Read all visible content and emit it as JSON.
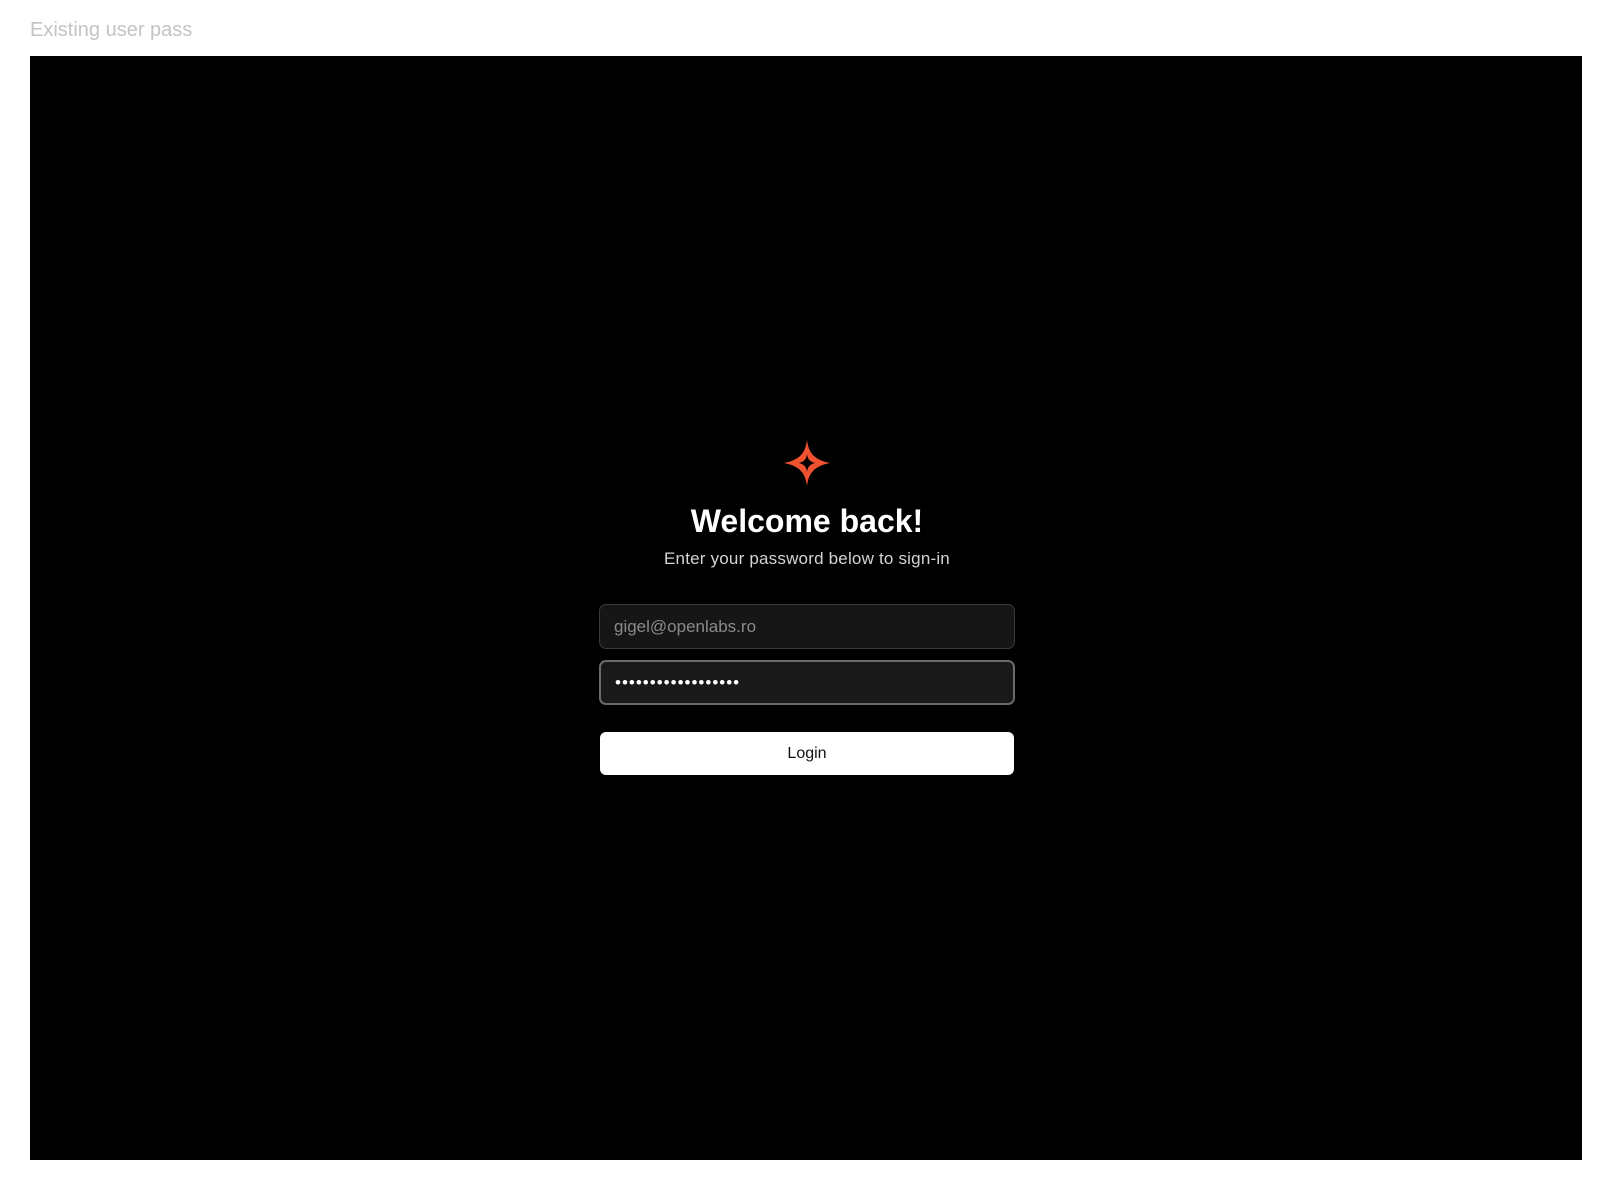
{
  "frame": {
    "label": "Existing user pass"
  },
  "login": {
    "logo_icon": "sparkle-star-icon",
    "accent_color": "#f0512f",
    "title": "Welcome back!",
    "subtitle": "Enter your password below to sign-in",
    "email": {
      "placeholder": "gigel@openlabs.ro",
      "value": ""
    },
    "password": {
      "value": "••••••••••••••••••"
    },
    "login_button_label": "Login"
  }
}
